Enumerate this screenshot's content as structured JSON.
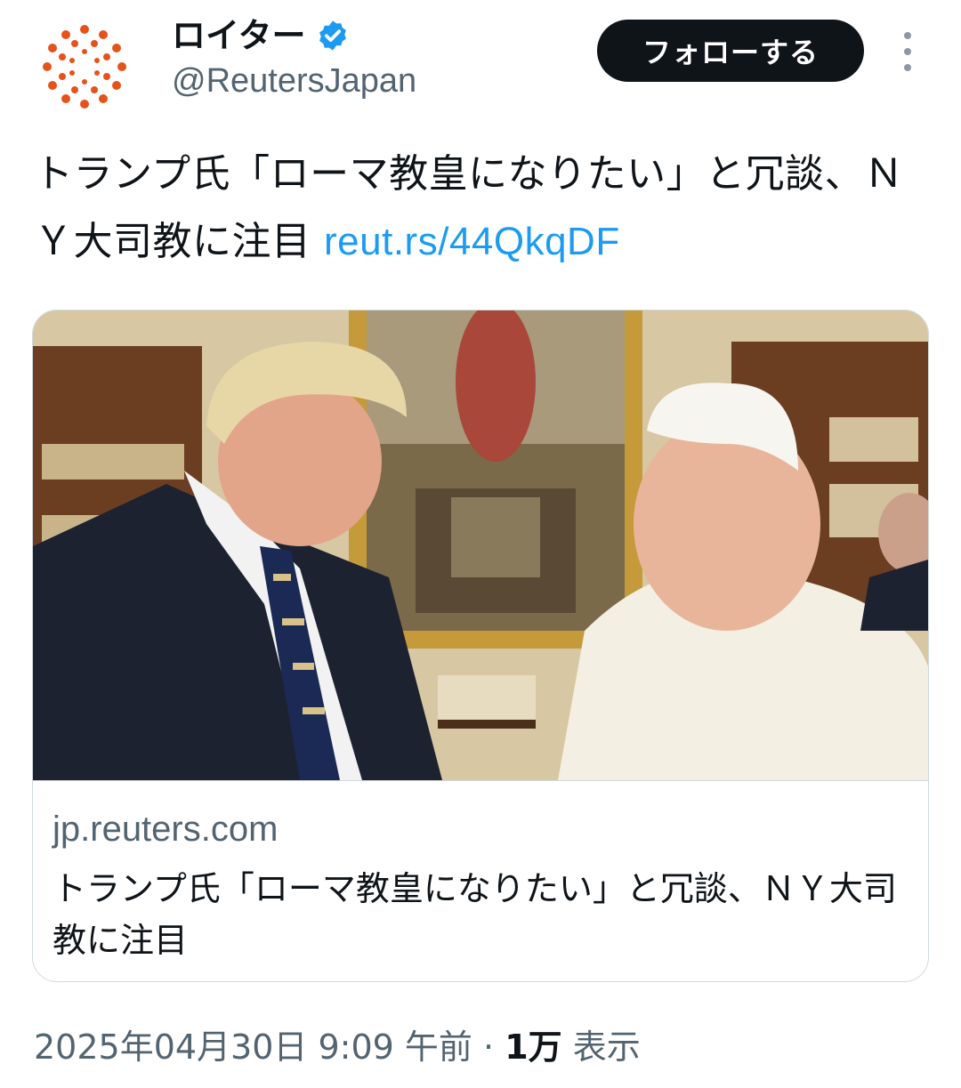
{
  "account": {
    "display_name": "ロイター",
    "handle": "@ReutersJapan",
    "follow_label": "フォローする"
  },
  "tweet": {
    "text": "トランプ氏「ローマ教皇になりたい」と冗談、ＮＹ大司教に注目",
    "link": "reut.rs/44QkqDF"
  },
  "card": {
    "domain": "jp.reuters.com",
    "title": "トランプ氏「ローマ教皇になりたい」と冗談、ＮＹ大司教に注目"
  },
  "meta": {
    "timestamp": "2025年04月30日 9:09 午前",
    "separator": "·",
    "views_count": "1万",
    "views_label": "表示"
  },
  "colors": {
    "accent": "#1d9bf0",
    "brand_logo": "#e5531b",
    "text_primary": "#0f1419",
    "text_secondary": "#536471",
    "follow_bg": "#0f1419"
  },
  "icons": [
    "reuters-logo-icon",
    "verified-badge-icon",
    "more-options-icon"
  ]
}
